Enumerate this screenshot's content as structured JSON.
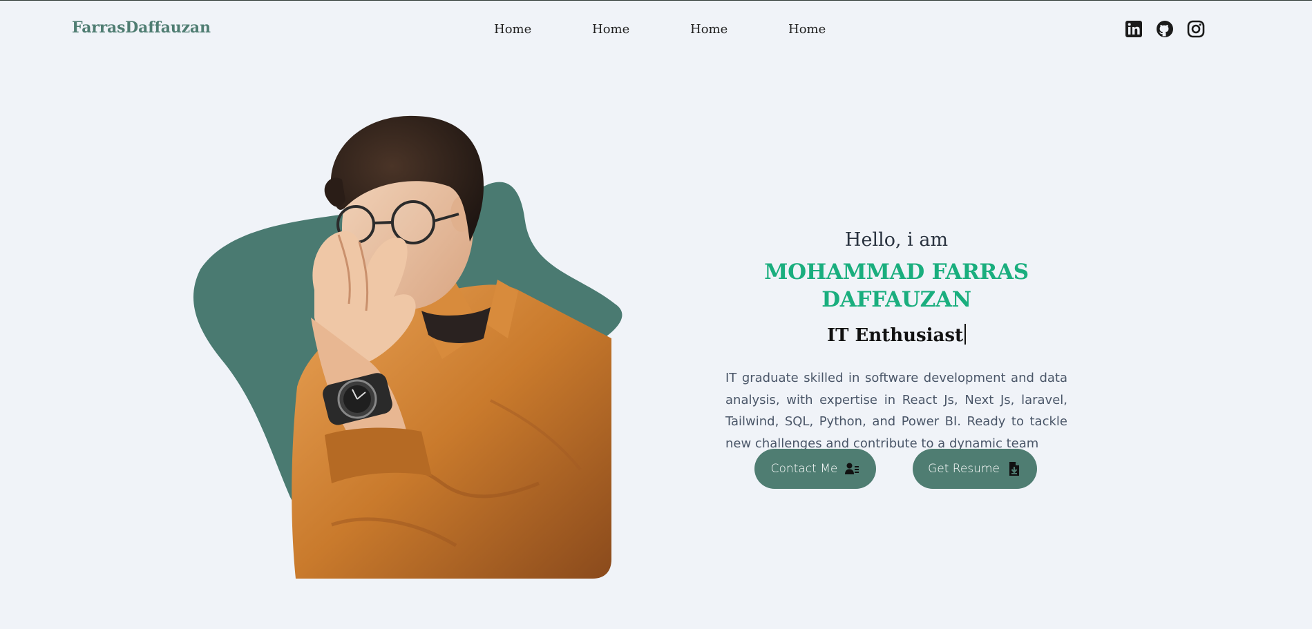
{
  "brand": {
    "name": "FarrasDaffauzan"
  },
  "nav": {
    "links": [
      {
        "label": "Home"
      },
      {
        "label": "Home"
      },
      {
        "label": "Home"
      },
      {
        "label": "Home"
      }
    ]
  },
  "socials": {
    "items": [
      {
        "icon": "linkedin-icon"
      },
      {
        "icon": "github-icon"
      },
      {
        "icon": "instagram-icon"
      }
    ]
  },
  "hero": {
    "greeting": "Hello, i am",
    "name": "MOHAMMAD FARRAS DAFFAUZAN",
    "role": "IT Enthusiast",
    "bio": "IT graduate skilled in software development and data analysis, with expertise in React Js, Next Js, laravel, Tailwind, SQL, Python, and Power BI. Ready to tackle new challenges and contribute to a dynamic team",
    "buttons": {
      "contact_label": "Contact Me",
      "contact_icon": "contact-card-icon",
      "resume_label": "Get Resume",
      "resume_icon": "file-download-icon"
    },
    "photo_icon": "portrait-photo"
  },
  "colors": {
    "background": "#f0f3f8",
    "brand": "#4f7d72",
    "accent": "#1aae7e",
    "blob": "#4a7a71",
    "shirt": "#c97a2c"
  }
}
